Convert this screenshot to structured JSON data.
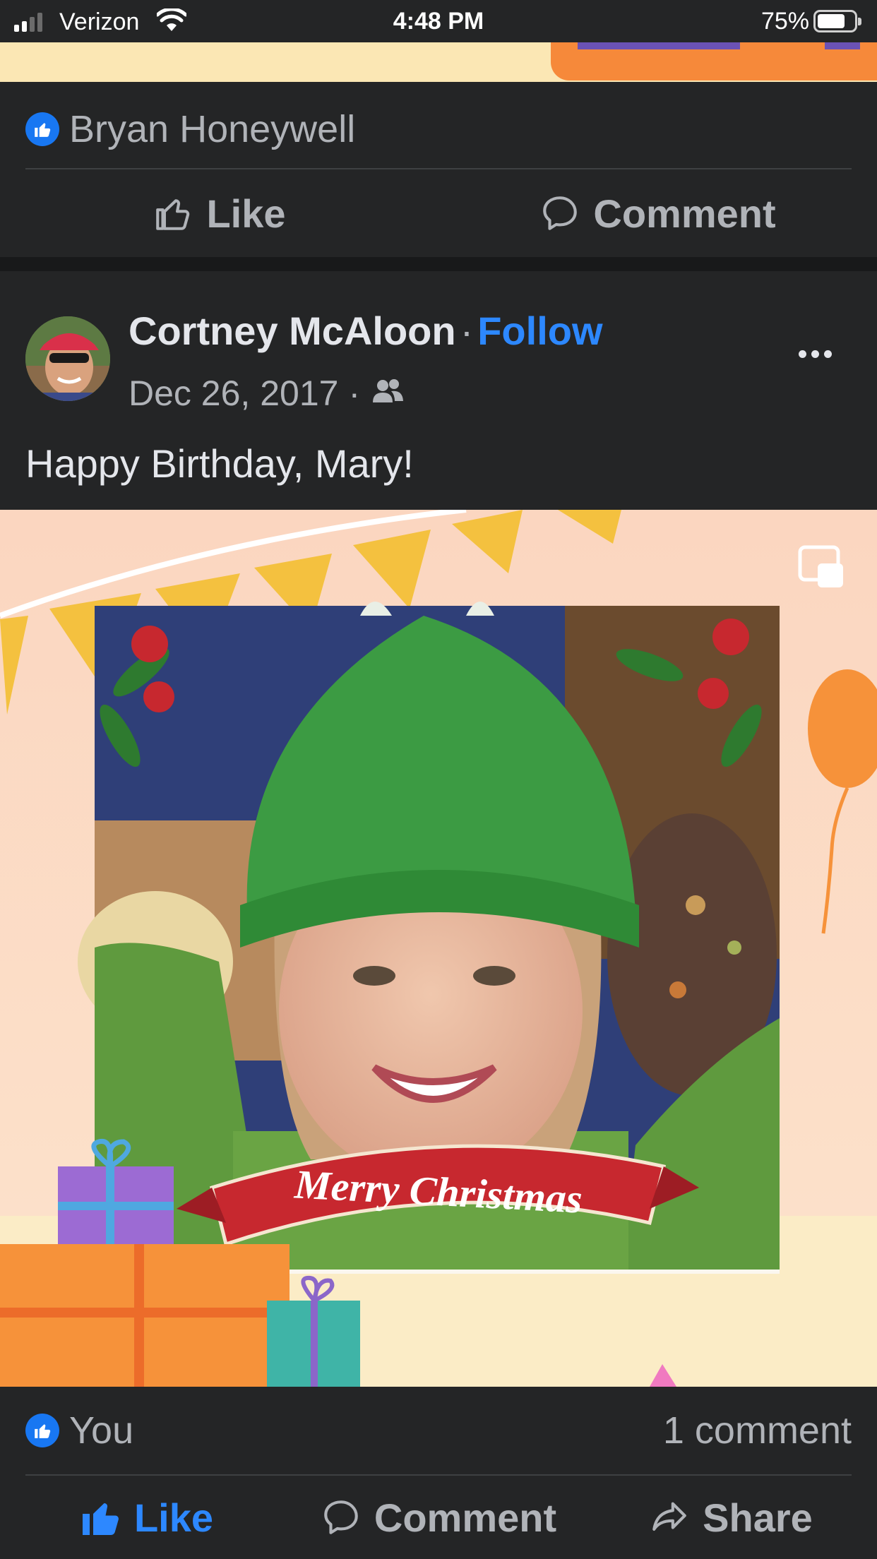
{
  "status_bar": {
    "carrier": "Verizon",
    "time": "4:48 PM",
    "battery_percent": "75%",
    "battery_level": 0.75,
    "signal_bars": 2
  },
  "previous_post": {
    "reaction_name": "Bryan Honeywell",
    "actions": {
      "like": "Like",
      "comment": "Comment"
    }
  },
  "post": {
    "author": "Cortney McAloon",
    "separator": "·",
    "follow_label": "Follow",
    "date": "Dec 26, 2017",
    "audience_icon": "friends-icon",
    "text": "Happy Birthday, Mary!",
    "image": {
      "banner_text": "Merry Christmas",
      "multi_image_icon": "multi-photo-icon"
    },
    "reaction_name": "You",
    "comment_count": "1 comment",
    "actions": {
      "like": "Like",
      "comment": "Comment",
      "share": "Share"
    }
  },
  "colors": {
    "background": "#18191a",
    "card": "#242526",
    "primary_text": "#e4e6eb",
    "secondary_text": "#b0b3b8",
    "accent_blue": "#2d88ff",
    "like_badge": "#1877f2"
  }
}
